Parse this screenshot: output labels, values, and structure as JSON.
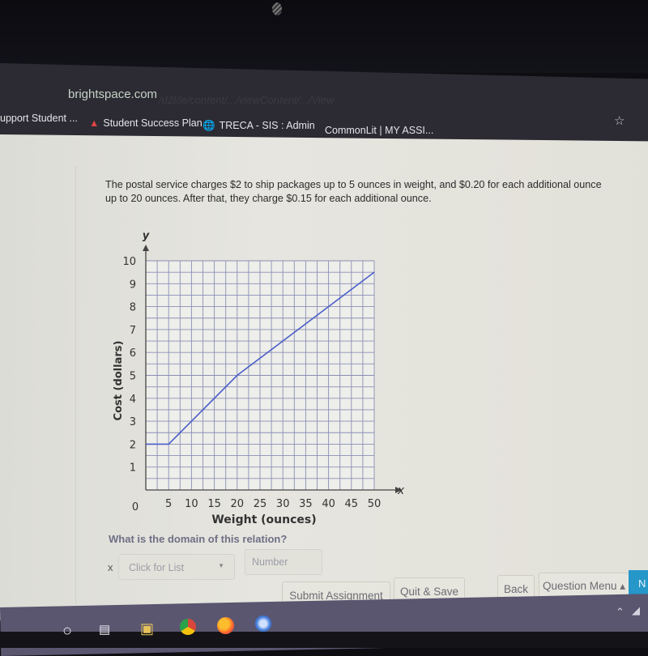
{
  "browser": {
    "url_domain": "brightspace.com",
    "url_path": "/d2l/le/content/.../viewContent/.../View",
    "bookmarks": [
      {
        "label": "upport Student ...",
        "icon": ""
      },
      {
        "label": "Student Success Plan",
        "icon": "flame-icon"
      },
      {
        "label": "TRECA - SIS : Admin",
        "icon": "globe-icon"
      },
      {
        "label": "CommonLit | MY ASSI...",
        "icon": ""
      }
    ],
    "star_icon": "star-icon"
  },
  "problem": {
    "text": "The postal service charges $2 to ship packages up to 5 ounces in weight, and $0.20 for each additional ounce up to 20 ounces. After that, they charge $0.15 for each additional ounce."
  },
  "chart_data": {
    "type": "line",
    "title": "",
    "xlabel": "Weight (ounces)",
    "ylabel": "Cost (dollars)",
    "x_axis_letter": "x",
    "y_axis_letter": "y",
    "origin_label": "0",
    "xlim": [
      0,
      50
    ],
    "ylim": [
      0,
      10
    ],
    "x_ticks": [
      "5",
      "10",
      "15",
      "20",
      "25",
      "30",
      "35",
      "40",
      "45",
      "50"
    ],
    "y_ticks": [
      "1",
      "2",
      "3",
      "4",
      "5",
      "6",
      "7",
      "8",
      "9",
      "10"
    ],
    "grid": true,
    "grid_step_x": 2.5,
    "grid_step_y": 0.5,
    "series": [
      {
        "name": "Cost",
        "color": "#4a5fc8",
        "points": [
          [
            0,
            2
          ],
          [
            5,
            2
          ],
          [
            20,
            5
          ],
          [
            50,
            9.5
          ]
        ]
      }
    ]
  },
  "question": {
    "text": "What is the domain of this relation?",
    "x_prefix": "x",
    "dropdown_placeholder": "Click for List",
    "number_placeholder": "Number"
  },
  "buttons": {
    "submit": "Submit Assignment",
    "quit_save": "Quit & Save",
    "back": "Back",
    "question_menu": "Question Menu ▴",
    "next": "N"
  },
  "taskbar": {
    "items": [
      "search-circle-icon",
      "task-view-icon",
      "file-explorer-icon",
      "chrome-icon",
      "firefox-icon",
      "app-icon"
    ]
  },
  "colors": {
    "accent_next": "#2597c9",
    "line": "#4a5fc8",
    "grid": "#8a8fb6"
  }
}
